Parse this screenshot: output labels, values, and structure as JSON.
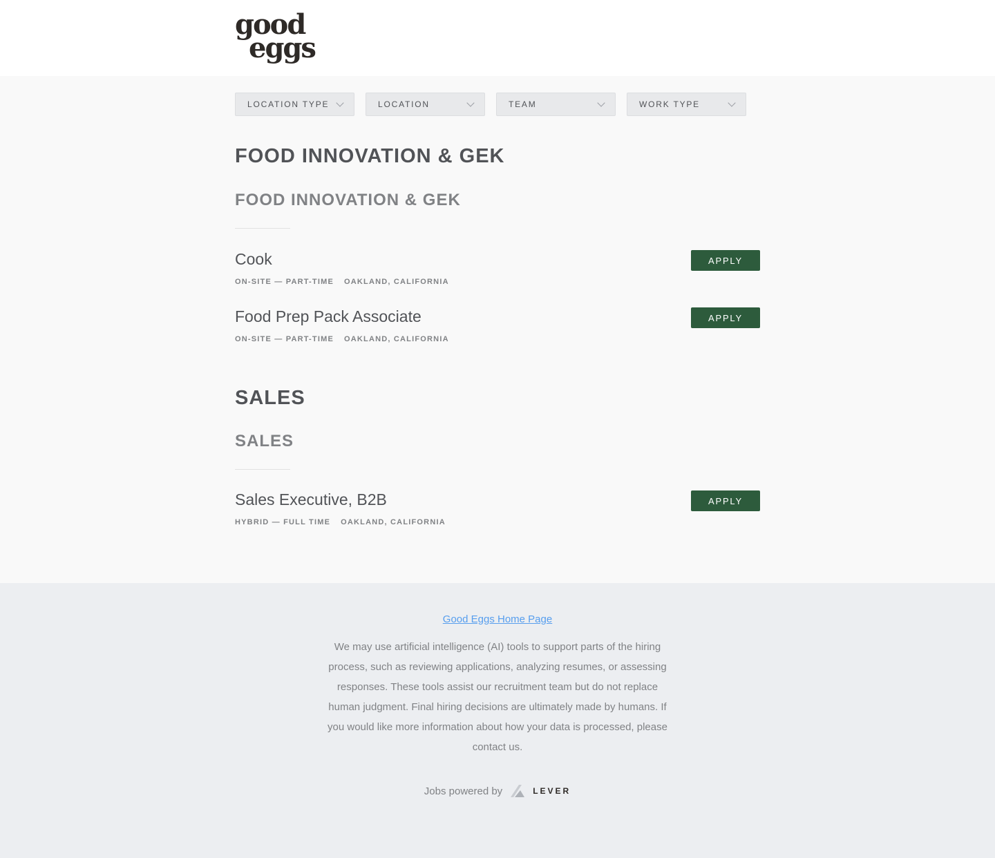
{
  "brand": {
    "logo_line1": "good",
    "logo_line2": "eggs"
  },
  "filters": [
    {
      "label": "LOCATION TYPE"
    },
    {
      "label": "LOCATION"
    },
    {
      "label": "TEAM"
    },
    {
      "label": "WORK TYPE"
    }
  ],
  "groups": [
    {
      "department": "FOOD INNOVATION & GEK",
      "team": "FOOD INNOVATION & GEK",
      "postings": [
        {
          "title": "Cook",
          "commitment": "ON-SITE — PART-TIME",
          "location": "OAKLAND, CALIFORNIA",
          "apply": "APPLY"
        },
        {
          "title": "Food Prep Pack Associate",
          "commitment": "ON-SITE — PART-TIME",
          "location": "OAKLAND, CALIFORNIA",
          "apply": "APPLY"
        }
      ]
    },
    {
      "department": "SALES",
      "team": "SALES",
      "postings": [
        {
          "title": "Sales Executive, B2B",
          "commitment": "HYBRID — FULL TIME",
          "location": "OAKLAND, CALIFORNIA",
          "apply": "APPLY"
        }
      ]
    }
  ],
  "footer": {
    "home_link": "Good Eggs Home Page",
    "disclaimer": "We may use artificial intelligence (AI) tools to support parts of the hiring process, such as reviewing applications, analyzing resumes, or assessing responses. These tools assist our recruitment team but do not replace human judgment. Final hiring decisions are ultimately made by humans. If you would like more information about how your data is processed, please contact us.",
    "powered_by": "Jobs powered by",
    "lever_word": "LEVER"
  },
  "colors": {
    "apply_bg": "#2d5b3c",
    "link": "#579eee"
  }
}
